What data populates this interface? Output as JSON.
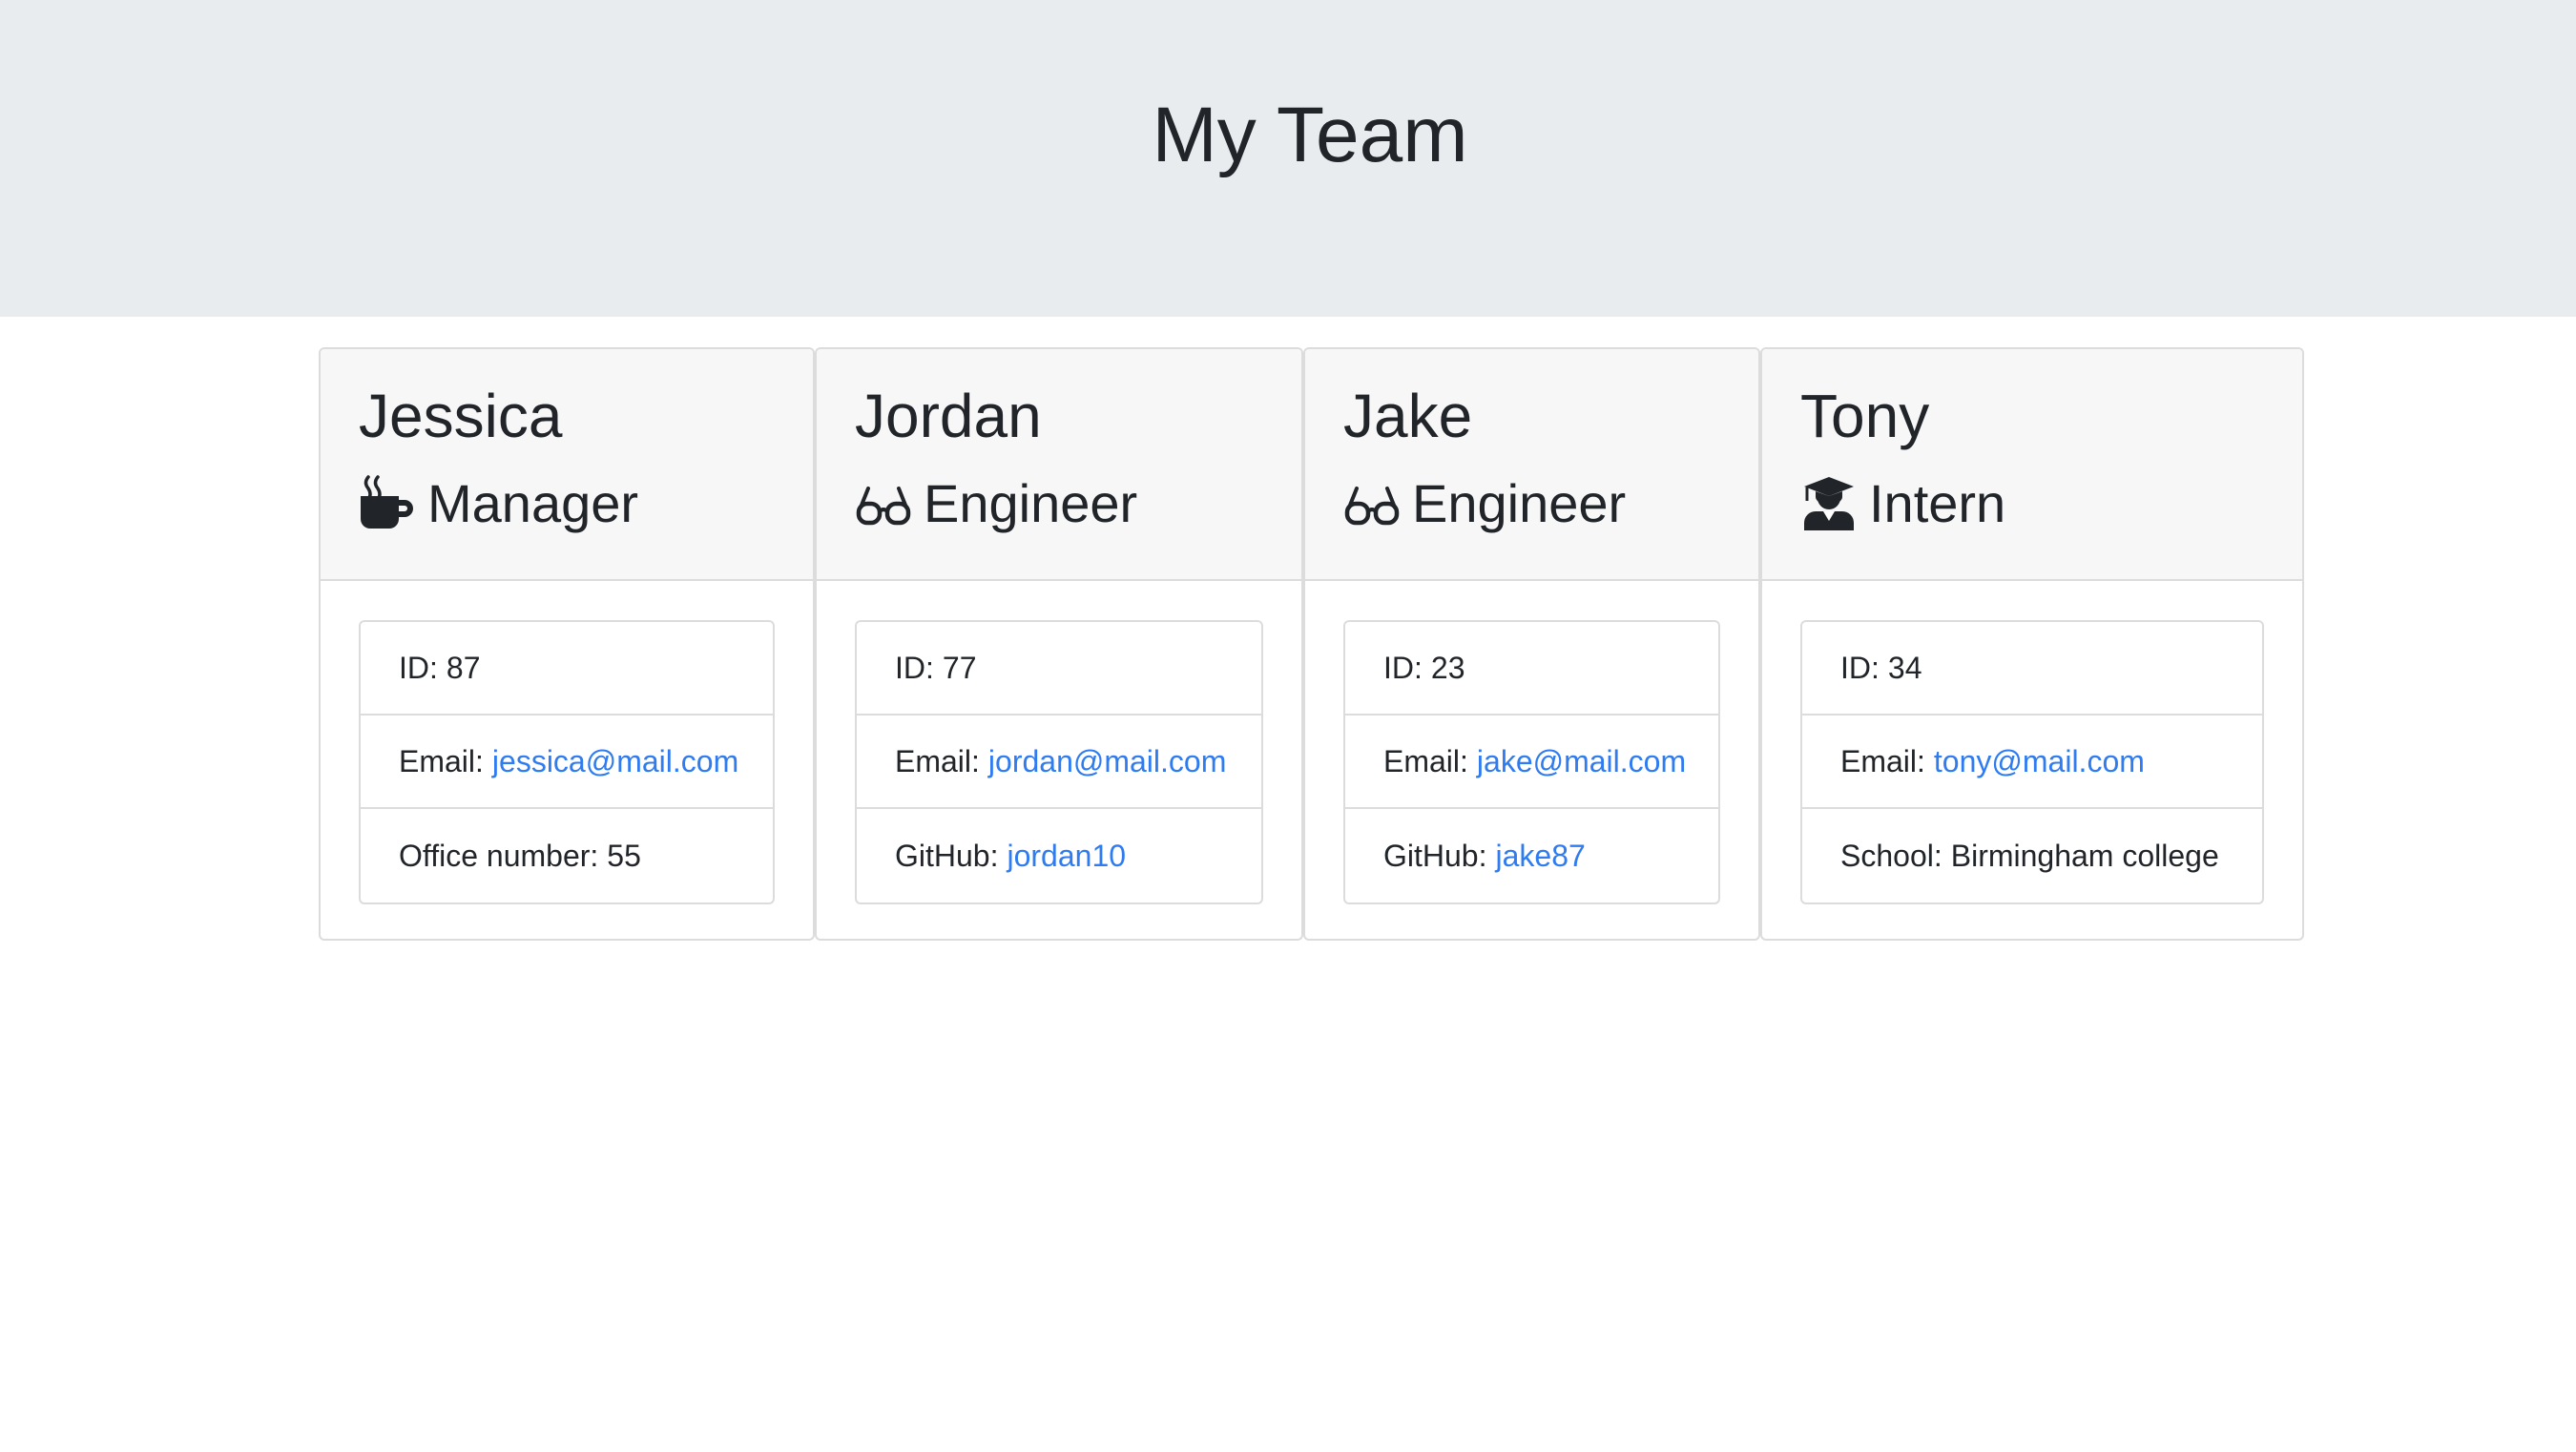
{
  "header": {
    "title": "My Team"
  },
  "team": [
    {
      "name": "Jessica",
      "role": "Manager",
      "role_icon": "coffee-icon",
      "id_label": "ID:",
      "id": "87",
      "email_label": "Email:",
      "email": "jessica@mail.com",
      "extra_label": "Office number:",
      "extra_value": "55",
      "extra_is_link": false
    },
    {
      "name": "Jordan",
      "role": "Engineer",
      "role_icon": "glasses-icon",
      "id_label": "ID:",
      "id": "77",
      "email_label": "Email:",
      "email": "jordan@mail.com",
      "extra_label": "GitHub:",
      "extra_value": "jordan10",
      "extra_is_link": true
    },
    {
      "name": "Jake",
      "role": "Engineer",
      "role_icon": "glasses-icon",
      "id_label": "ID:",
      "id": "23",
      "email_label": "Email:",
      "email": "jake@mail.com",
      "extra_label": "GitHub:",
      "extra_value": "jake87",
      "extra_is_link": true
    },
    {
      "name": "Tony",
      "role": "Intern",
      "role_icon": "graduate-icon",
      "id_label": "ID:",
      "id": "34",
      "email_label": "Email:",
      "email": "tony@mail.com",
      "extra_label": "School:",
      "extra_value": "Birmingham college",
      "extra_is_link": false
    }
  ],
  "colors": {
    "link": "#2f7bf0",
    "jumbotron": "#e9ecef",
    "card_header": "#f7f7f7",
    "text": "#212529"
  }
}
